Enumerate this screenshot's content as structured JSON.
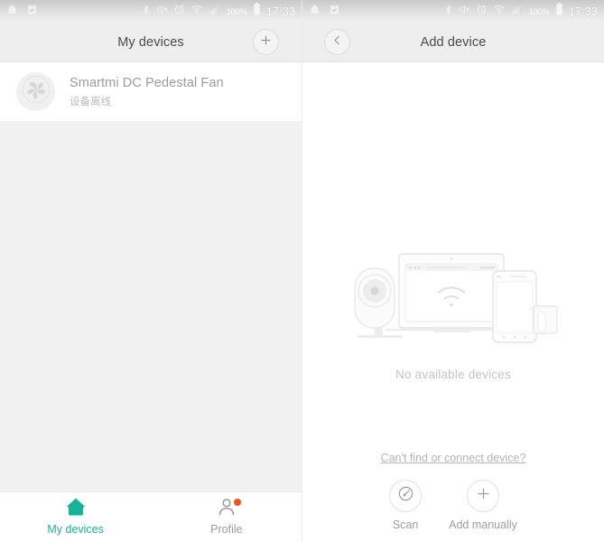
{
  "status_bar": {
    "icons_left": [
      "notification-bell-icon",
      "clipboard-icon"
    ],
    "icons_right": [
      "bluetooth-icon",
      "mute-icon",
      "alarm-icon",
      "wifi-icon",
      "signal-icon"
    ],
    "battery_percent": "100%",
    "time": "17:33"
  },
  "left_pane": {
    "header": {
      "title": "My devices",
      "add_button_icon": "plus-icon"
    },
    "devices": [
      {
        "name": "Smartmi DC Pedestal Fan",
        "status": "设备离线",
        "icon": "fan-icon"
      }
    ],
    "bottom_nav": [
      {
        "label": "My devices",
        "icon": "home-icon",
        "active": true,
        "badge": false
      },
      {
        "label": "Profile",
        "icon": "person-icon",
        "active": false,
        "badge": true
      }
    ]
  },
  "right_pane": {
    "header": {
      "title": "Add device",
      "back_button_icon": "chevron-left-icon"
    },
    "illustration": {
      "items": [
        "camera-icon",
        "laptop-icon",
        "wifi-icon",
        "phone-icon",
        "router-icon"
      ]
    },
    "empty_text": "No available devices",
    "help_link": "Can't find or connect device?",
    "actions": [
      {
        "label": "Scan",
        "icon": "scan-icon"
      },
      {
        "label": "Add manually",
        "icon": "plus-icon"
      }
    ]
  },
  "colors": {
    "accent_teal": "#16b396",
    "badge_orange": "#f4511e",
    "header_bg": "#eeeeee",
    "pane_bg": "#f1f1f1"
  }
}
